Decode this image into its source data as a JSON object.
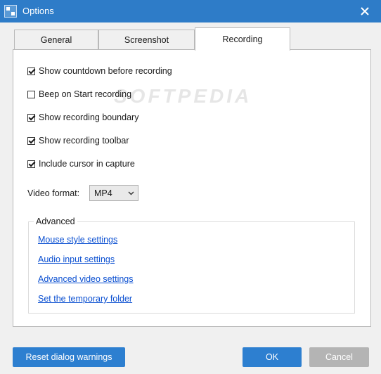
{
  "window": {
    "title": "Options"
  },
  "tabs": [
    {
      "label": "General",
      "active": false
    },
    {
      "label": "Screenshot",
      "active": false
    },
    {
      "label": "Recording",
      "active": true
    }
  ],
  "recording": {
    "checkboxes": [
      {
        "label": "Show countdown before recording",
        "checked": true
      },
      {
        "label": "Beep on Start recording",
        "checked": false
      },
      {
        "label": "Show recording boundary",
        "checked": true
      },
      {
        "label": "Show recording toolbar",
        "checked": true
      },
      {
        "label": "Include cursor in capture",
        "checked": true
      }
    ],
    "video_format": {
      "label": "Video format:",
      "value": "MP4"
    },
    "advanced": {
      "title": "Advanced",
      "links": [
        "Mouse style settings",
        "Audio input settings",
        "Advanced video settings",
        "Set the temporary folder"
      ]
    }
  },
  "watermark": "SOFTPEDIA",
  "buttons": {
    "reset": "Reset dialog warnings",
    "ok": "OK",
    "cancel": "Cancel"
  },
  "colors": {
    "titlebar": "#2e7cc8",
    "primary_button": "#2d7fd0",
    "secondary_button": "#b4b4b4",
    "link": "#0a4fd1"
  }
}
